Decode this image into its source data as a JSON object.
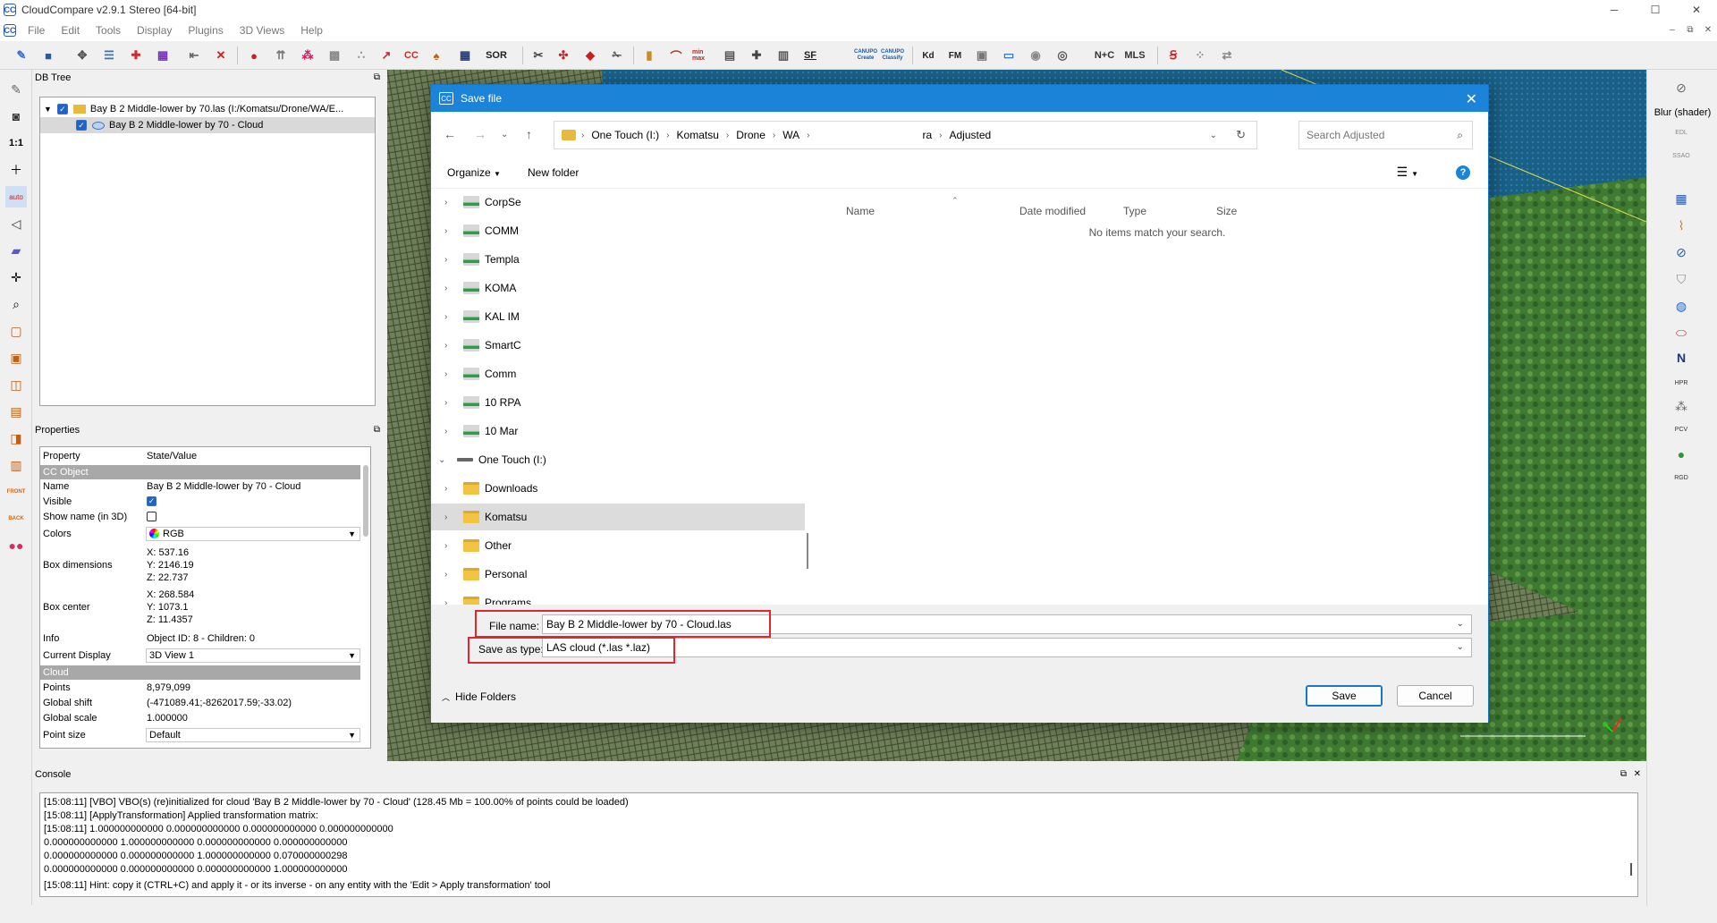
{
  "window": {
    "title": "CloudCompare v2.9.1 Stereo [64-bit]",
    "app_icon": "CC",
    "controls": [
      "─",
      "☐",
      "✕"
    ],
    "mdi_controls": [
      "–",
      "⧉",
      "✕"
    ]
  },
  "menu": [
    "File",
    "Edit",
    "Tools",
    "Display",
    "Plugins",
    "3D Views",
    "Help"
  ],
  "toolbar": {
    "sor_label": "SOR",
    "sf_label": "SF",
    "canupo_create": "CANUPO Create",
    "canupo_classify": "CANUPO Classify",
    "kd_label": "Kd",
    "fm_label": "FM",
    "n_c_label": "N+C",
    "mls_label": "MLS",
    "hidden_points_label": "min max"
  },
  "left_tools": [
    "1:1",
    "auto",
    "FRONT",
    "BACK"
  ],
  "db_tree": {
    "title": "DB Tree",
    "items": [
      {
        "label": "Bay B 2 Middle-lower by 70.las (I:/Komatsu/Drone/WA/E..."
      },
      {
        "label": "Bay B 2 Middle-lower by 70 - Cloud"
      }
    ]
  },
  "properties": {
    "title": "Properties",
    "header_property": "Property",
    "header_value": "State/Value",
    "section_cc_object": "CC Object",
    "name_key": "Name",
    "name_val": "Bay B 2 Middle-lower by 70 - Cloud",
    "visible_key": "Visible",
    "show_name_key": "Show name (in 3D)",
    "colors_key": "Colors",
    "colors_val": "RGB",
    "box_dim_key": "Box dimensions",
    "box_dim_x": "X: 537.16",
    "box_dim_y": "Y: 2146.19",
    "box_dim_z": "Z: 22.737",
    "box_center_key": "Box center",
    "box_center_x": "X: 268.584",
    "box_center_y": "Y: 1073.1",
    "box_center_z": "Z: 11.4357",
    "info_key": "Info",
    "info_val": "Object ID: 8 - Children: 0",
    "current_display_key": "Current Display",
    "current_display_val": "3D View 1",
    "section_cloud": "Cloud",
    "points_key": "Points",
    "points_val": "8,979,099",
    "global_shift_key": "Global shift",
    "global_shift_val": "(-471089.41;-8262017.59;-33.02)",
    "global_scale_key": "Global scale",
    "global_scale_val": "1.000000",
    "point_size_key": "Point size",
    "point_size_val": "Default"
  },
  "right_panel": {
    "blur_label": "Blur (shader)",
    "edl_label": "EDL",
    "ssao_label": "SSAO",
    "n_label": "N",
    "hpr_label": "HPR",
    "pcv_label": "PCV",
    "rgd_label": "RGD"
  },
  "console": {
    "title": "Console",
    "lines": [
      "[15:08:11] [VBO] VBO(s) (re)initialized for cloud 'Bay B 2 Middle-lower by 70 - Cloud' (128.45 Mb = 100.00% of points could be loaded)",
      "[15:08:11] [ApplyTransformation] Applied transformation matrix:",
      "[15:08:11] 1.000000000000 0.000000000000 0.000000000000 0.000000000000",
      "0.000000000000 1.000000000000 0.000000000000 0.000000000000",
      "0.000000000000 0.000000000000 1.000000000000 0.070000000298",
      "0.000000000000 0.000000000000 0.000000000000 1.000000000000",
      "[15:08:11] Hint: copy it (CTRL+C) and apply it - or its inverse - on any entity with the 'Edit > Apply transformation' tool"
    ]
  },
  "dialog": {
    "title": "Save file",
    "breadcrumb": [
      "One Touch (I:)",
      "Komatsu",
      "Drone",
      "WA",
      "ra",
      "Adjusted"
    ],
    "search_placeholder": "Search Adjusted",
    "organize": "Organize",
    "new_folder": "New folder",
    "nav_items": [
      {
        "label": "CorpSe",
        "type": "drive"
      },
      {
        "label": "COMM",
        "type": "drive"
      },
      {
        "label": "Templa",
        "type": "drive"
      },
      {
        "label": "KOMA",
        "type": "drive"
      },
      {
        "label": "KAL IM",
        "type": "drive"
      },
      {
        "label": "SmartC",
        "type": "drive"
      },
      {
        "label": "Comm",
        "type": "drive"
      },
      {
        "label": "10 RPA",
        "type": "drive"
      },
      {
        "label": "10 Mar",
        "type": "drive"
      },
      {
        "label": "One Touch (I:)",
        "type": "drive"
      },
      {
        "label": "Downloads",
        "type": "folder"
      },
      {
        "label": "Komatsu",
        "type": "folder"
      },
      {
        "label": "Other",
        "type": "folder"
      },
      {
        "label": "Personal",
        "type": "folder"
      },
      {
        "label": "Programs",
        "type": "folder"
      }
    ],
    "columns": [
      "Name",
      "Date modified",
      "Type",
      "Size"
    ],
    "empty_message": "No items match your search.",
    "file_name_label": "File name:",
    "file_name_value": "Bay B 2 Middle-lower by 70 - Cloud.las",
    "save_type_label": "Save as type:",
    "save_type_value": "LAS cloud (*.las *.laz)",
    "hide_folders": "Hide Folders",
    "save_button": "Save",
    "cancel_button": "Cancel"
  }
}
